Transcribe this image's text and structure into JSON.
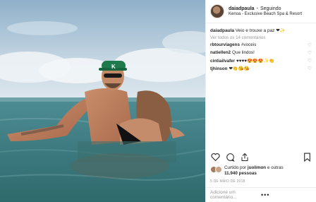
{
  "post": {
    "username": "daiadpaula",
    "separator": "•",
    "follow_status": "Seguindo",
    "location": "Kenoa - Exclusive Beach Spa & Resort",
    "caption_user": "daiadpaula",
    "caption_text": "Veio e trouxe a paz ❤✨",
    "view_all_comments": "Ver todos os 14 comentários",
    "comments": [
      {
        "user": "rbtourviagens",
        "text": "#voceis"
      },
      {
        "user": "natiellen2",
        "text": "Que lindos!"
      },
      {
        "user": "cintiailvafer",
        "text": "♥♥♥♥😍😍😍✨👏"
      },
      {
        "user": "tjhinson",
        "text": "❤👏😘😘"
      }
    ],
    "likes_prefix": "Curtido por",
    "likes_user": "juolimon",
    "likes_middle": "e outras",
    "likes_count": "11.940 pessoas",
    "date": "5 DE MAIO DE 2018",
    "comment_placeholder": "Adicione um comentário...",
    "more_dots": "•••"
  },
  "icons": {
    "like": "heart-outline-icon",
    "comment": "comment-bubble-icon",
    "share": "share-icon",
    "save": "bookmark-icon",
    "comment_like": "small-heart-icon"
  },
  "colors": {
    "cap_green": "#1f7a4c",
    "sea": "#3f7f86",
    "sky": "#b7cddd"
  }
}
